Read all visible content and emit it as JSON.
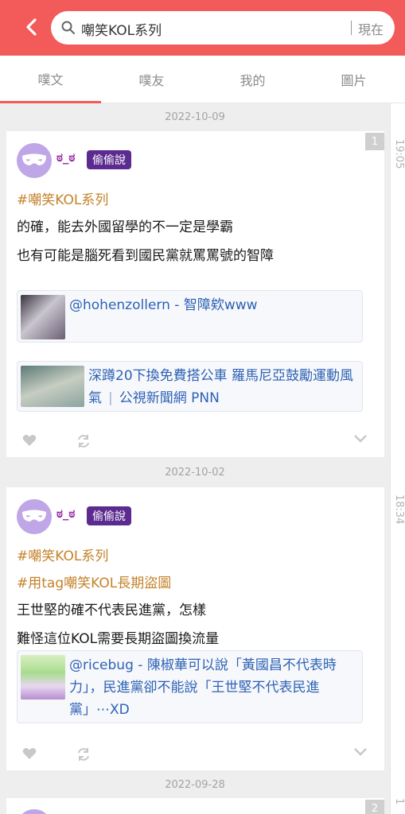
{
  "search": {
    "query": "嘲笑KOL系列",
    "now_label": "現在"
  },
  "tabs": [
    {
      "label": "噗文"
    },
    {
      "label": "噗友"
    },
    {
      "label": "我的"
    },
    {
      "label": "圖片"
    }
  ],
  "rail_times": [
    "19:05",
    "18:34",
    "1"
  ],
  "posts": [
    {
      "date": "2022-10-09",
      "badge": "1",
      "nick": "ಠ_ಠ",
      "role": "偷偷說",
      "tags": [
        "#嘲笑KOL系列"
      ],
      "lines": [
        "的確，能去外國留學的不一定是學霸",
        "也有可能是腦死看到國民黨就罵罵號的智障"
      ],
      "links": [
        {
          "text": "@hohenzollern - 智障欸www",
          "source": ""
        },
        {
          "text": "深蹲20下換免費搭公車 羅馬尼亞鼓勵運動風氣",
          "source": "公視新聞網 PNN"
        }
      ]
    },
    {
      "date": "2022-10-02",
      "badge": "",
      "nick": "ಠ_ಠ",
      "role": "偷偷說",
      "tags": [
        "#嘲笑KOL系列",
        "#用tag嘲笑KOL長期盜圖"
      ],
      "lines": [
        "王世堅的確不代表民進黨，怎樣",
        "難怪這位KOL需要長期盜圖換流量"
      ],
      "links": [
        {
          "text": "@ricebug - 陳椒華可以說「黃國昌不代表時力」，民進黨卻不能說「王世堅不代表民進黨」⋯XD",
          "source": ""
        }
      ]
    },
    {
      "date": "2022-09-28",
      "badge": "2"
    }
  ],
  "colors": {
    "accent": "#f35a5a",
    "tag": "#c4822a",
    "link": "#2d62b5",
    "nick": "#9a2aa3"
  }
}
